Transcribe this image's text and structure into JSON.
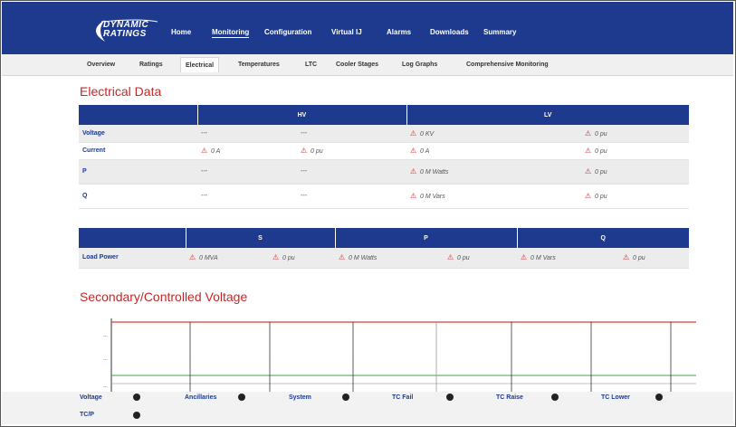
{
  "brand": {
    "line1": "DYNAMIC",
    "line2": "RATINGS"
  },
  "nav": [
    "Home",
    "Monitoring",
    "Configuration",
    "Virtual IJ",
    "Alarms",
    "Downloads",
    "Summary"
  ],
  "subtabs": [
    "Overview",
    "Ratings",
    "Electrical",
    "Temperatures",
    "LTC",
    "Cooler Stages",
    "Log Graphs",
    "Comprehensive Monitoring"
  ],
  "electrical": {
    "title": "Electrical Data",
    "headers": [
      "",
      "HV",
      "LV"
    ],
    "rows": [
      {
        "label": "Voltage",
        "c1": "---",
        "c2": "---",
        "c3": "0 KV",
        "c4": "0 pu"
      },
      {
        "label": "Current",
        "c1": "0 A",
        "c2": "0 pu",
        "c3": "0 A",
        "c4": "0 pu"
      },
      {
        "label": "P",
        "c1": "---",
        "c2": "---",
        "c3": "0 M Watts",
        "c4": "0 pu"
      },
      {
        "label": "Q",
        "c1": "---",
        "c2": "---",
        "c3": "0 M Vars",
        "c4": "0 pu"
      }
    ]
  },
  "load": {
    "headers": [
      "",
      "S",
      "P",
      "Q"
    ],
    "row": {
      "label": "Load Power",
      "cells": [
        "0 MVA",
        "0 pu",
        "0 M Watts",
        "0 pu",
        "0 M Vars",
        "0 pu"
      ]
    }
  },
  "voltage_chart": {
    "title": "Secondary/Controlled Voltage",
    "ticks": [
      "---",
      "---",
      "---"
    ],
    "line_colors": {
      "upper": "#e53935",
      "lower": "#43a047"
    }
  },
  "legend": {
    "row1": [
      "Voltage",
      "Ancillaries",
      "System",
      "TC Fail",
      "TC Raise",
      "TC Lower"
    ],
    "row2": [
      "TC/P"
    ]
  },
  "colors": {
    "header": "#1d3a8e",
    "accent": "#c62828",
    "warning": "#d32f2f"
  }
}
